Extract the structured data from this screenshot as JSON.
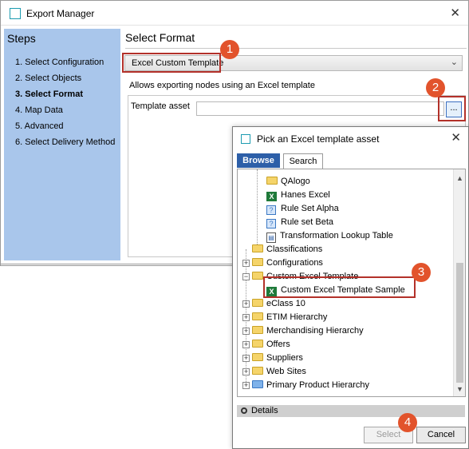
{
  "window": {
    "title": "Export Manager",
    "close_glyph": "✕"
  },
  "steps": {
    "title": "Steps",
    "items": [
      "1. Select Configuration",
      "2. Select Objects",
      "3. Select Format",
      "4. Map Data",
      "5. Advanced",
      "6. Select Delivery Method"
    ],
    "active_index": 2
  },
  "main": {
    "title": "Select Format",
    "format_value": "Excel Custom Template",
    "format_description": "Allows exporting nodes using an Excel template",
    "template_label": "Template asset",
    "template_value": "",
    "browse_label": "..."
  },
  "markers": [
    "1",
    "2",
    "3",
    "4"
  ],
  "dialog": {
    "title": "Pick an Excel template asset",
    "close_glyph": "✕",
    "tabs": [
      "Browse",
      "Search"
    ],
    "tree": [
      {
        "label": "QAlogo",
        "icon": "folder-icon"
      },
      {
        "label": "Hanes Excel",
        "icon": "excel-icon"
      },
      {
        "label": "Rule Set Alpha",
        "icon": "rule-icon"
      },
      {
        "label": "Rule set Beta",
        "icon": "rule-icon"
      },
      {
        "label": "Transformation Lookup Table",
        "icon": "document-icon"
      },
      {
        "label": "Classifications",
        "icon": "folder-icon"
      },
      {
        "label": "Configurations",
        "icon": "folder-icon"
      },
      {
        "label": "Custom Excel Template",
        "icon": "folder-icon"
      },
      {
        "label": "Custom Excel Template Sample",
        "icon": "excel-icon"
      },
      {
        "label": "eClass 10",
        "icon": "folder-icon"
      },
      {
        "label": "ETIM Hierarchy",
        "icon": "folder-icon"
      },
      {
        "label": "Merchandising Hierarchy",
        "icon": "folder-icon"
      },
      {
        "label": "Offers",
        "icon": "folder-icon"
      },
      {
        "label": "Suppliers",
        "icon": "folder-icon"
      },
      {
        "label": "Web Sites",
        "icon": "folder-icon"
      },
      {
        "label": "Primary Product Hierarchy",
        "icon": "blue-folder-icon"
      }
    ],
    "details_label": "Details",
    "select_label": "Select",
    "cancel_label": "Cancel"
  },
  "colors": {
    "accent": "#2d5fa8",
    "marker": "#e2532c",
    "highlight": "#b3312a",
    "steps_bg": "#a9c6eb"
  }
}
